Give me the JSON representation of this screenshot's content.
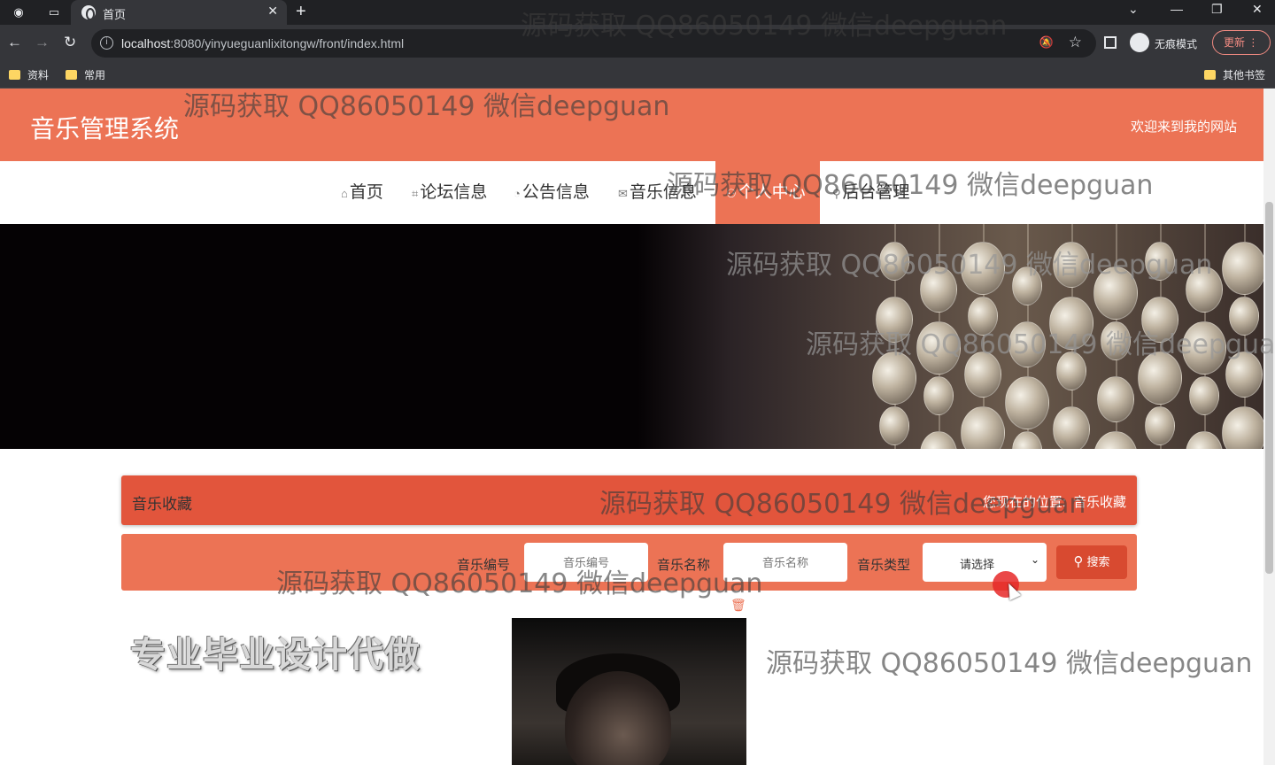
{
  "browser": {
    "tab_title": "首页",
    "new_tab": "+",
    "url_host": "localhost",
    "url_rest": ":8080/yinyueguanlixitongw/front/index.html",
    "incognito_label": "无痕模式",
    "update_label": "更新",
    "bookmarks": [
      "资料",
      "常用"
    ],
    "other_bookmarks": "其他书签"
  },
  "site": {
    "title": "音乐管理系统",
    "welcome": "欢迎来到我的网站",
    "nav": [
      {
        "icon": "⌂",
        "label": "首页"
      },
      {
        "icon": "⌗",
        "label": "论坛信息"
      },
      {
        "icon": "◔",
        "label": "公告信息"
      },
      {
        "icon": "✉",
        "label": "音乐信息"
      },
      {
        "icon": "⚇",
        "label": "个人中心"
      },
      {
        "icon": "⚲",
        "label": "后台管理"
      }
    ]
  },
  "breadcrumb": {
    "title": "音乐收藏",
    "location_label": "您现在的位置:",
    "location_value": "音乐收藏"
  },
  "search": {
    "field1_label": "音乐编号",
    "field1_placeholder": "音乐编号",
    "field2_label": "音乐名称",
    "field2_placeholder": "音乐名称",
    "field3_label": "音乐类型",
    "field3_value": "请选择",
    "button_label": "搜索"
  },
  "promo_text": "专业毕业设计代做",
  "watermark": "源码获取 QQ86050149 微信deepguan",
  "colors": {
    "accent": "#ec7355",
    "crumb": "#e2553c",
    "button": "#d84a30"
  }
}
